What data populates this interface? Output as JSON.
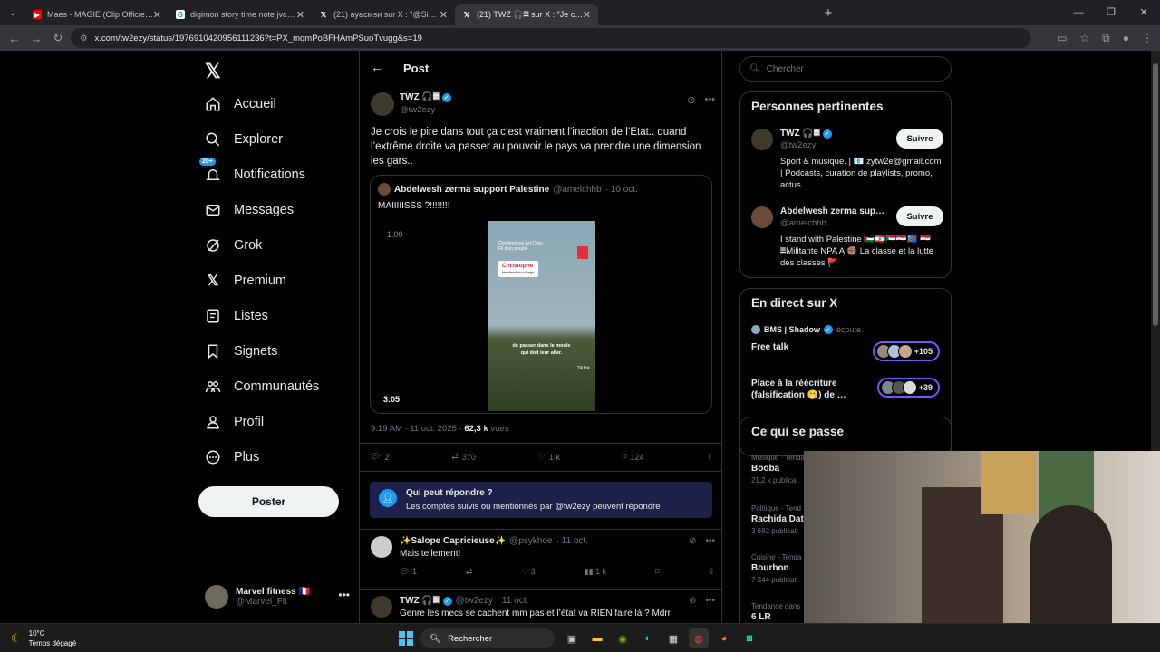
{
  "browser": {
    "tabs": [
      {
        "title": "Maes - MAGIE (Clip Officiel) - Y",
        "favicon": "youtube-icon",
        "active": false
      },
      {
        "title": "digimon story time note jvc - Re",
        "favicon": "google-icon",
        "active": false
      },
      {
        "title": "(21) ayacмsи sur X : \"@SindyOt",
        "favicon": "x-icon",
        "active": false
      },
      {
        "title": "(21) TWZ 🎧𝄜 sur X : \"Je crois",
        "favicon": "x-icon",
        "active": true
      }
    ],
    "url": "x.com/tw2ezy/status/1976910420956111236?t=PX_mqmPoBFHAmPSuoTvugg&s=19"
  },
  "sidebar": {
    "nav": [
      {
        "label": "Accueil",
        "icon": "home-icon"
      },
      {
        "label": "Explorer",
        "icon": "search-icon"
      },
      {
        "label": "Notifications",
        "icon": "bell-icon",
        "badge": "20+"
      },
      {
        "label": "Messages",
        "icon": "mail-icon"
      },
      {
        "label": "Grok",
        "icon": "grok-icon"
      },
      {
        "label": "Premium",
        "icon": "x-logo-icon"
      },
      {
        "label": "Listes",
        "icon": "list-icon"
      },
      {
        "label": "Signets",
        "icon": "bookmark-icon"
      },
      {
        "label": "Communautés",
        "icon": "communities-icon"
      },
      {
        "label": "Profil",
        "icon": "profile-icon"
      },
      {
        "label": "Plus",
        "icon": "more-circle-icon"
      }
    ],
    "post_button": "Poster",
    "account": {
      "name": "Marvel fitness 🇫🇷",
      "handle": "@Marvel_Flt"
    }
  },
  "main": {
    "header_title": "Post",
    "tweet": {
      "name": "TWZ 🎧𝄜",
      "handle": "@tw2ezy",
      "text": "Je crois le pire dans tout ça c’est vraiment l’inaction de l’Etat.. quand l’extrême droite va passer au pouvoir le pays va prendre une dimension les gars..",
      "quote": {
        "name": "Abdelwesh zerma support Palestine",
        "handle": "@amelchhb",
        "date": "· 10 oct.",
        "text": "MAIIIIISSS ?!!!!!!!!",
        "axis_label": "1.00",
        "video_title": "Conférences Art-Cités\nFil d'un peuple",
        "video_name": "Christophe",
        "video_name_sub": "Habitant du village",
        "video_subtitle": "de passer dans le moule\nqui doit leur aller.",
        "video_watermark": "TikTok",
        "duration": "3:05"
      },
      "time": "9:19 AM · 11 oct. 2025 · ",
      "views_count": "62,3 k",
      "views_label": " vues",
      "actions": {
        "replies": "2",
        "reposts": "370",
        "likes": "1 k",
        "bookmarks": "124"
      }
    },
    "reply_info": {
      "title": "Qui peut répondre ?",
      "text": "Les comptes suivis ou mentionnés par @tw2ezy peuvent répondre"
    },
    "replies": [
      {
        "name": "✨Salope Capricieuse✨",
        "handle": "@psykhoe",
        "date": "· 11 oct.",
        "text": "Mais tellement!",
        "replies": "1",
        "reposts": "",
        "likes": "3",
        "views": "1 k"
      },
      {
        "name": "TWZ 🎧𝄜",
        "handle": "@tw2ezy",
        "date": "· 11 oct.",
        "text": "Genre les mecs se cachent mm pas et l’état va RIEN faire là ? Mdrr"
      }
    ]
  },
  "right": {
    "search_placeholder": "Chercher",
    "relevant": {
      "title": "Personnes pertinentes",
      "people": [
        {
          "name": "TWZ 🎧𝄜",
          "handle": "@tw2ezy",
          "bio": "Sport & musique. | 📧 zytw2e@gmail.com | Podcasts, curation de playlists, promo, actus",
          "button": "Suivre"
        },
        {
          "name": "Abdelwesh zerma sup…",
          "handle": "@amelchhb",
          "bio": "I stand with Palestine 🇵🇸🇱🇧🇸🇩🇾🇪🇨🇩 🇪🇬𝄜Militante NPA A ✊🏽 La classe et la lutte des classes 🚩",
          "button": "Suivre"
        }
      ]
    },
    "live": {
      "title": "En direct sur X",
      "host": "BMS | Shadow",
      "host_action": "écoute.",
      "spaces": [
        {
          "title": "Free talk",
          "count": "+105"
        },
        {
          "title": "Place à la réécriture (falsification 🫢) de …",
          "count": "+39"
        }
      ]
    },
    "trends": {
      "title": "Ce qui se passe",
      "items": [
        {
          "category": "Musique · Tenda",
          "name": "Booba",
          "count": "21,2 k publicat"
        },
        {
          "category": "Politique · Tend",
          "name": "Rachida Dati",
          "count": "3 682 publicati"
        },
        {
          "category": "Cuisine · Tenda",
          "name": "Bourbon",
          "count": "7 344 publicati"
        },
        {
          "category": "Tendance dans",
          "name": "6 LR",
          "count": ""
        }
      ]
    }
  },
  "taskbar": {
    "temperature": "10°C",
    "weather": "Temps dégagé",
    "search_label": "Rechercher"
  }
}
